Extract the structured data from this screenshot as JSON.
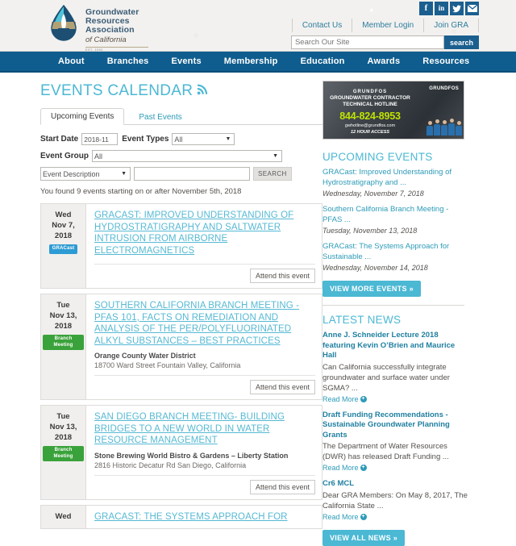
{
  "header": {
    "logo": {
      "line1": "Groundwater",
      "line2": "Resources",
      "line3": "Association",
      "line4": "of California",
      "est": "EST. 1992"
    },
    "social": [
      {
        "name": "facebook-icon",
        "glyph": "f"
      },
      {
        "name": "linkedin-icon",
        "glyph": "in"
      },
      {
        "name": "twitter-icon",
        "glyph": "t"
      },
      {
        "name": "email-icon",
        "glyph": "envelope"
      }
    ],
    "links": [
      "Contact Us",
      "Member Login",
      "Join GRA"
    ],
    "search": {
      "placeholder": "Search Our Site",
      "value": "",
      "button": "search"
    }
  },
  "nav": {
    "items": [
      "About",
      "Branches",
      "Events",
      "Membership",
      "Education",
      "Awards",
      "Resources"
    ]
  },
  "main": {
    "title": "EVENTS CALENDAR",
    "rss_icon": "rss-icon",
    "tabs": [
      {
        "label": "Upcoming Events",
        "active": true
      },
      {
        "label": "Past Events",
        "active": false
      }
    ],
    "filters": {
      "start_date_label": "Start Date",
      "start_date_value": "2018-11",
      "event_types_label": "Event Types",
      "event_types_value": "All",
      "event_group_label": "Event Group",
      "event_group_value": "All",
      "search_field_value": "Event Description",
      "search_text_value": "",
      "search_button": "SEARCH"
    },
    "found_text": "You found 9 events starting on or after November 5th, 2018",
    "attend_label": "Attend this event",
    "events": [
      {
        "dow": "Wed",
        "monthday": "Nov 7,",
        "year": "2018",
        "badge": "GRACast",
        "badge_type": "gracast",
        "title": "GRACAST: IMPROVED UNDERSTANDING OF HYDROSTRATIGRAPHY AND SALTWATER INTRUSION FROM AIRBORNE ELECTROMAGNETICS",
        "venue": "",
        "address": ""
      },
      {
        "dow": "Tue",
        "monthday": "Nov 13,",
        "year": "2018",
        "badge": "Branch Meeting",
        "badge_type": "branch",
        "title": "SOUTHERN CALIFORNIA BRANCH MEETING - PFAS 101, FACTS ON REMEDIATION AND ANALYSIS OF THE PER/POLYFLUORINATED ALKYL SUBSTANCES – BEST PRACTICES",
        "venue": "Orange County Water District",
        "address": "18700 Ward Street Fountain Valley, California"
      },
      {
        "dow": "Tue",
        "monthday": "Nov 13,",
        "year": "2018",
        "badge": "Branch Meeting",
        "badge_type": "branch",
        "title": "SAN DIEGO BRANCH MEETING- BUILDING BRIDGES TO A NEW WORLD IN WATER RESOURCE MANAGEMENT",
        "venue": "Stone Brewing World Bistro & Gardens – Liberty Station",
        "address": "2816 Historic Decatur Rd San Diego, California"
      },
      {
        "dow": "Wed",
        "monthday": "",
        "year": "",
        "badge": "",
        "badge_type": "gracast",
        "title": "GRACAST: THE SYSTEMS APPROACH FOR",
        "venue": "",
        "address": ""
      }
    ]
  },
  "rail": {
    "ad": {
      "brand": "GRUNDFOS",
      "line1": "GRUNDFOS",
      "line2": "GROUNDWATER CONTRACTOR TECHNICAL HOTLINE",
      "phone": "844-824-8953",
      "email": "gwhotline@grundfos.com",
      "hours": "12 HOUR ACCESS"
    },
    "upcoming": {
      "heading": "UPCOMING EVENTS",
      "items": [
        {
          "title": "GRACast: Improved Understanding of Hydrostratigraphy and ...",
          "date": "Wednesday, November 7, 2018"
        },
        {
          "title": "Southern California Branch Meeting - PFAS ...",
          "date": "Tuesday, November 13, 2018"
        },
        {
          "title": "GRACast: The Systems Approach for Sustainable ...",
          "date": "Wednesday, November 14, 2018"
        }
      ],
      "cta": "VIEW MORE EVENTS »"
    },
    "news": {
      "heading": "LATEST NEWS",
      "read_more": "Read More",
      "items": [
        {
          "title": "Anne J. Schneider Lecture 2018 featuring Kevin O’Brien and Maurice Hall",
          "excerpt": "Can California successfully integrate groundwater and surface water under SGMA? ..."
        },
        {
          "title": "Draft Funding Recommendations - Sustainable Groundwater Planning Grants",
          "excerpt": "The Department of Water Resources (DWR) has released Draft Funding ..."
        },
        {
          "title": "Cr6 MCL",
          "excerpt": "Dear GRA Members:  On May 8, 2017, The California State ..."
        }
      ],
      "cta": "VIEW ALL NEWS »"
    }
  }
}
